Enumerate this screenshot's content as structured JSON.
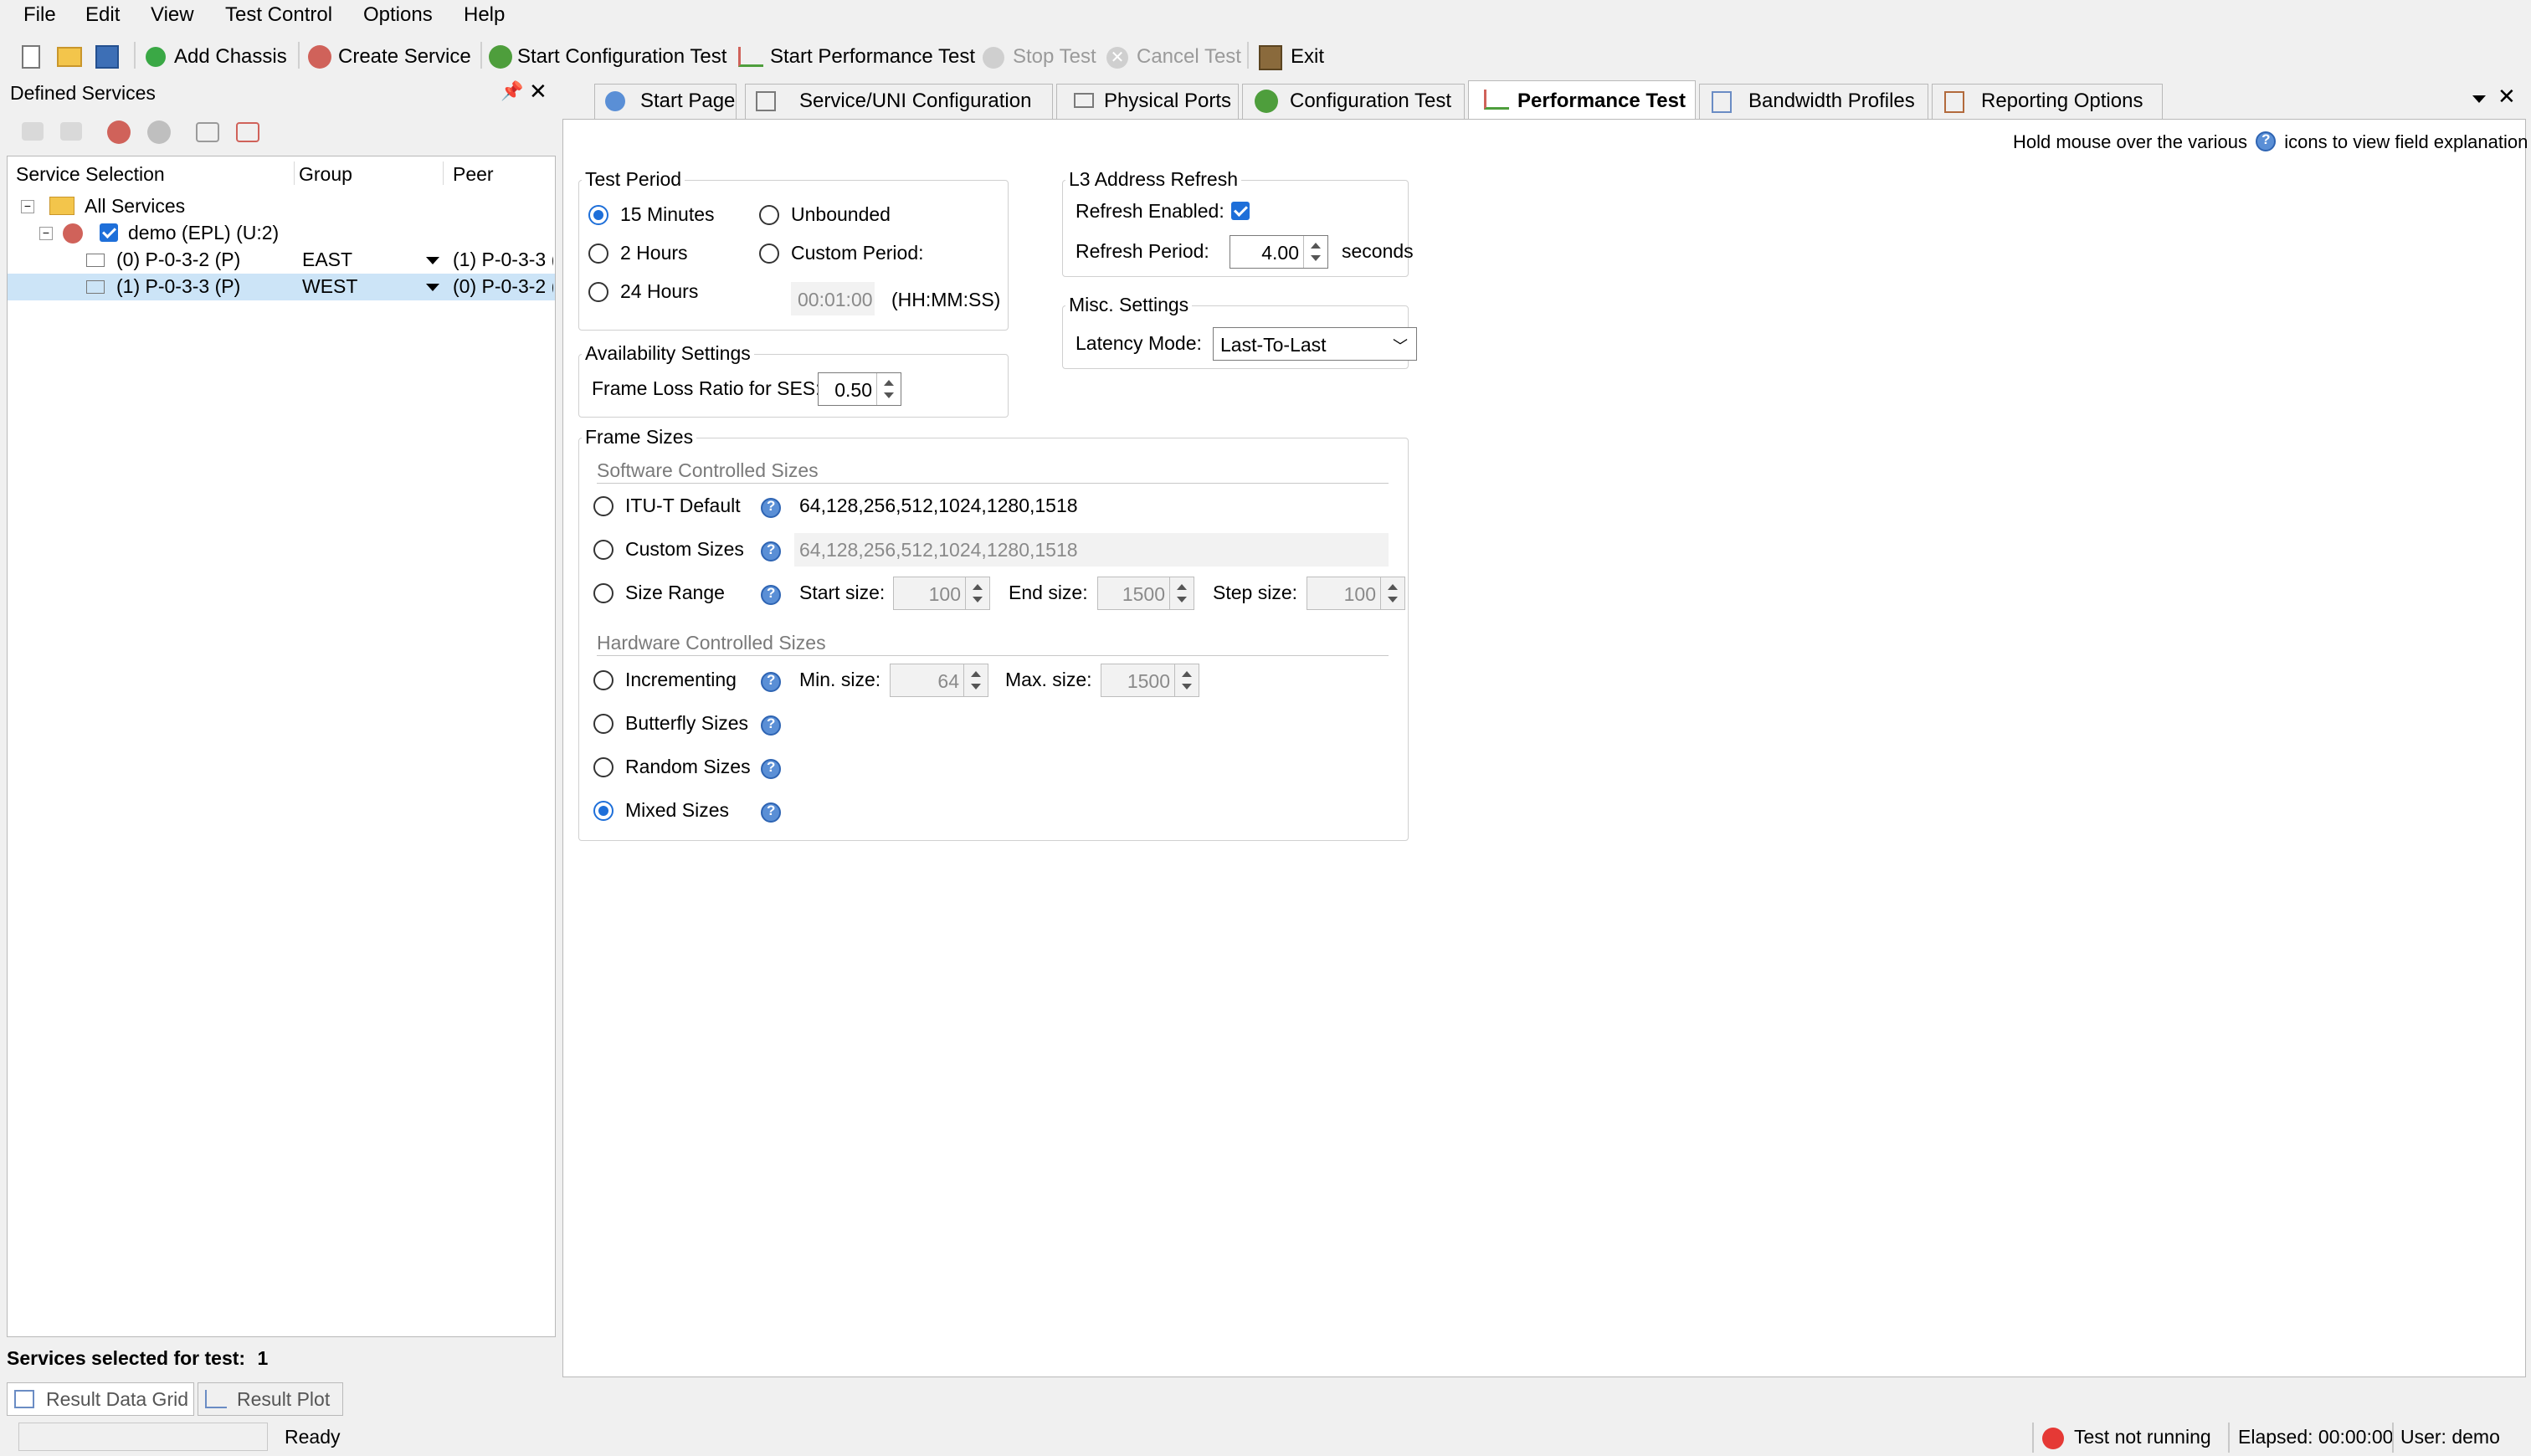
{
  "menu": [
    "File",
    "Edit",
    "View",
    "Test Control",
    "Options",
    "Help"
  ],
  "toolbar": {
    "add_chassis": "Add Chassis",
    "create_service": "Create Service",
    "start_config": "Start Configuration Test",
    "start_perf": "Start Performance Test",
    "stop_test": "Stop Test",
    "cancel_test": "Cancel Test",
    "exit": "Exit"
  },
  "left": {
    "title": "Defined Services",
    "columns": [
      "Service Selection",
      "Group",
      "Peer"
    ],
    "root": "All Services",
    "service": "demo (EPL) (U:2)",
    "rows": [
      {
        "name": "(0) P-0-3-2 (P)",
        "group": "EAST",
        "peer": "(1) P-0-3-3 ("
      },
      {
        "name": "(1) P-0-3-3 (P)",
        "group": "WEST",
        "peer": "(0) P-0-3-2 ("
      }
    ],
    "selected_count_label": "Services selected for test:",
    "selected_count": "1",
    "bottom_tabs": [
      "Result Data Grid",
      "Result Plot"
    ]
  },
  "tabs": [
    "Start Page",
    "Service/UNI Configuration",
    "Physical Ports",
    "Configuration Test",
    "Performance Test",
    "Bandwidth Profiles",
    "Reporting Options"
  ],
  "active_tab": "Performance Test",
  "hint": {
    "before": "Hold mouse over the various",
    "after": "icons to view field explanation"
  },
  "test_period": {
    "legend": "Test Period",
    "options": [
      "15 Minutes",
      "2 Hours",
      "24 Hours",
      "Unbounded",
      "Custom Period:"
    ],
    "selected": "15 Minutes",
    "custom_value": "00:01:00",
    "custom_format": "(HH:MM:SS)"
  },
  "availability": {
    "legend": "Availability Settings",
    "label": "Frame Loss Ratio for SES:",
    "value": "0.50"
  },
  "l3": {
    "legend": "L3 Address Refresh",
    "enabled_label": "Refresh Enabled:",
    "enabled": true,
    "period_label": "Refresh Period:",
    "period_value": "4.00",
    "period_unit": "seconds"
  },
  "misc": {
    "legend": "Misc. Settings",
    "latency_label": "Latency Mode:",
    "latency_value": "Last-To-Last"
  },
  "frame_sizes": {
    "legend": "Frame Sizes",
    "software_heading": "Software Controlled Sizes",
    "itu_label": "ITU-T Default",
    "itu_value": "64,128,256,512,1024,1280,1518",
    "custom_label": "Custom Sizes",
    "custom_value": "64,128,256,512,1024,1280,1518",
    "range_label": "Size Range",
    "start_label": "Start size:",
    "start_value": "100",
    "end_label": "End size:",
    "end_value": "1500",
    "step_label": "Step size:",
    "step_value": "100",
    "hardware_heading": "Hardware Controlled Sizes",
    "incrementing_label": "Incrementing",
    "min_label": "Min. size:",
    "min_value": "64",
    "max_label": "Max. size:",
    "max_value": "1500",
    "butterfly_label": "Butterfly Sizes",
    "random_label": "Random Sizes",
    "mixed_label": "Mixed Sizes",
    "selected": "Mixed Sizes"
  },
  "status": {
    "ready": "Ready",
    "test_state": "Test not running",
    "elapsed": "Elapsed: 00:00:00",
    "user": "User: demo"
  },
  "colors": {
    "accent": "#1e6fd9",
    "selection": "#cce4f7",
    "red_light": "#e53935"
  }
}
